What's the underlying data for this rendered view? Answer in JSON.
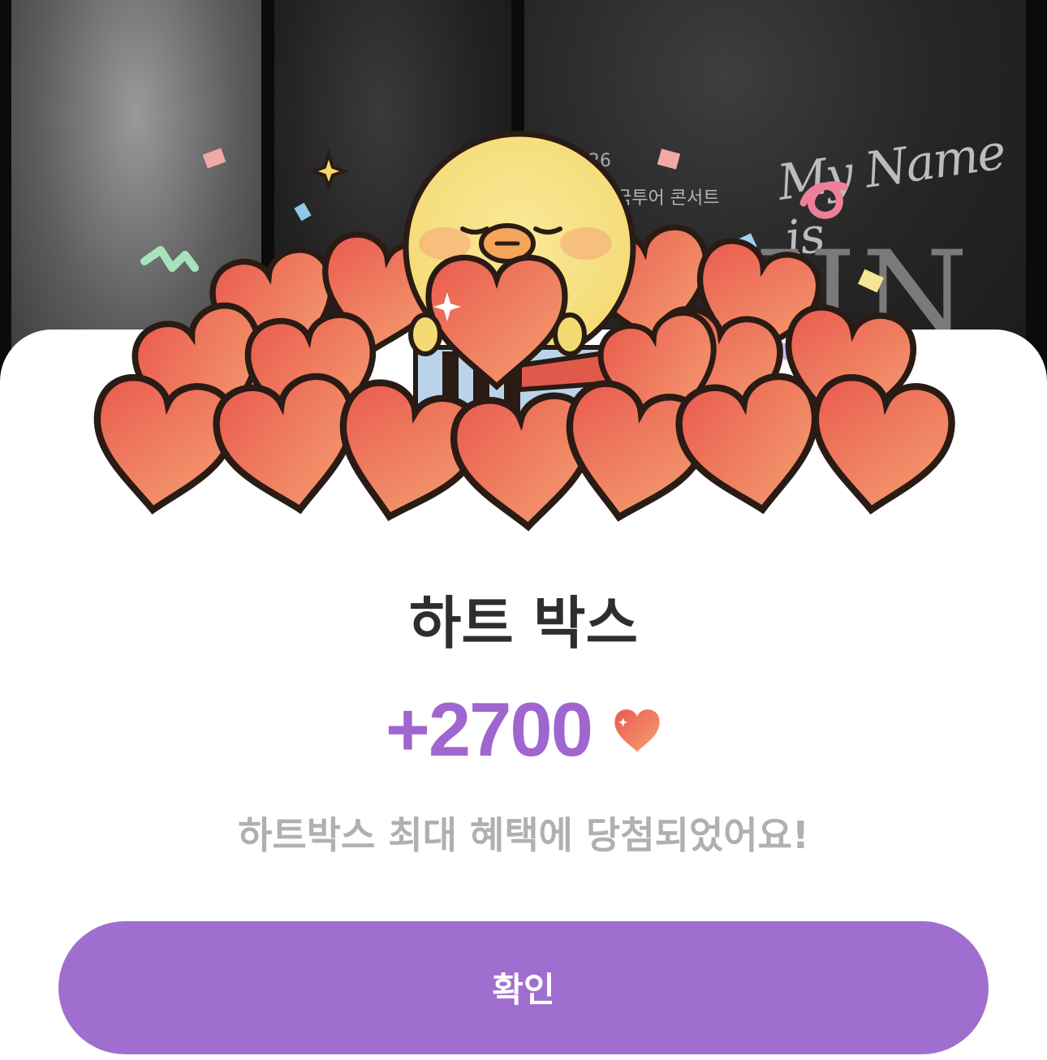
{
  "background": {
    "date_text": "05.26",
    "subtitle_text": "국투어 콘서트",
    "script_text": "My Name is",
    "big_text": "JIN"
  },
  "popup": {
    "title": "하트 박스",
    "amount": "+2700",
    "amount_icon": "heart-icon",
    "description": "하트박스 최대 혜택에 당첨되었어요!",
    "confirm_label": "확인"
  },
  "colors": {
    "accent": "#a06ecf",
    "amount": "#a066cf",
    "title": "#2e2e2e",
    "description": "#b0b0b0",
    "heart": "#ee6a55"
  }
}
